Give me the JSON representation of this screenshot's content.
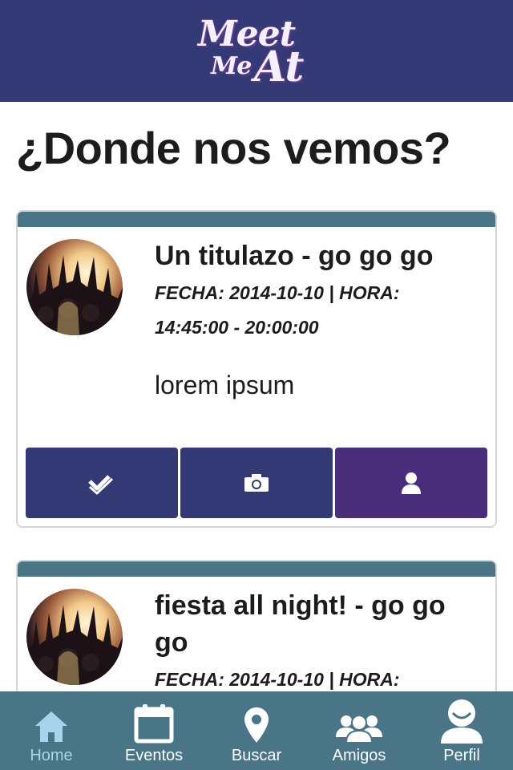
{
  "app": {
    "logo_line1": "Meet",
    "logo_line2": "Me",
    "logo_line3": "At"
  },
  "page_title": "¿Donde nos vemos?",
  "events": [
    {
      "title": "Un titulazo - go go go",
      "date_line": "FECHA: 2014-10-10 | HORA:",
      "time_line": "14:45:00 - 20:00:00",
      "description": "lorem ipsum",
      "actions": [
        {
          "icon": "checkin-icon",
          "color": "#323974"
        },
        {
          "icon": "camera-icon",
          "color": "#323974"
        },
        {
          "icon": "person-icon",
          "color": "#4a2e7c"
        }
      ]
    },
    {
      "title": "fiesta all night! - go go go",
      "date_line": "FECHA: 2014-10-10 | HORA:"
    }
  ],
  "tabbar": {
    "active": "Home",
    "tabs": [
      {
        "label": "Home",
        "icon": "home-icon"
      },
      {
        "label": "Eventos",
        "icon": "calendar-icon"
      },
      {
        "label": "Buscar",
        "icon": "location-pin-icon"
      },
      {
        "label": "Amigos",
        "icon": "group-icon"
      },
      {
        "label": "Perfil",
        "icon": "profile-icon"
      }
    ]
  },
  "colors": {
    "header_bg": "#333a76",
    "card_strip": "#497586",
    "button_blue": "#323974",
    "button_purple": "#4a2e7c",
    "tabbar_bg": "#497586",
    "tab_active": "#a8d3ec"
  }
}
